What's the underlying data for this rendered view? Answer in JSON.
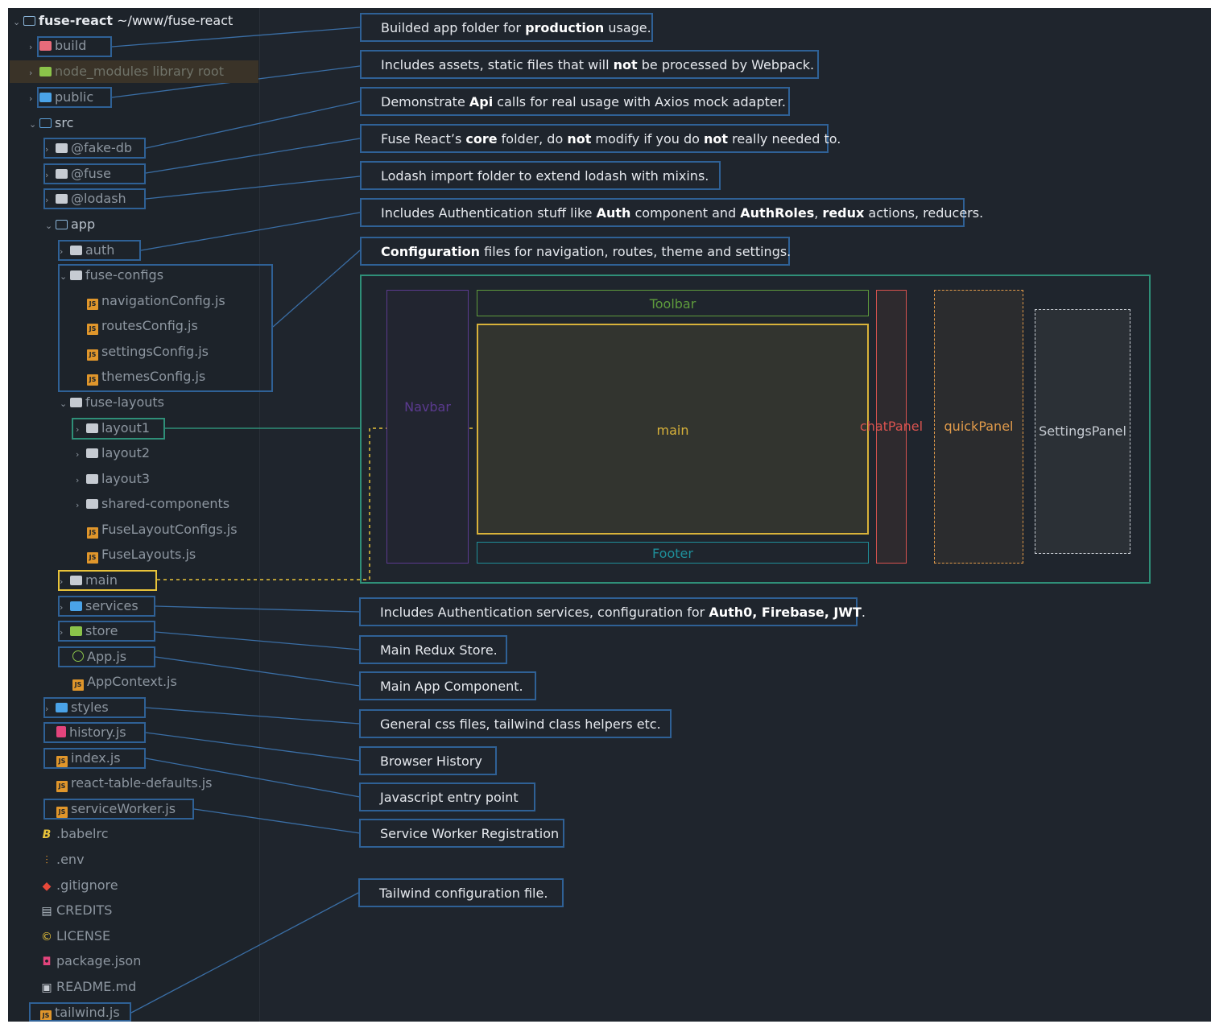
{
  "tree": {
    "root_name": "fuse-react",
    "root_path": "~/www/fuse-react",
    "items": {
      "build": "build",
      "node_modules": "node_modules",
      "node_modules_note": "library root",
      "public": "public",
      "src": "src",
      "fake_db": "@fake-db",
      "fuse": "@fuse",
      "lodash": "@lodash",
      "app": "app",
      "auth": "auth",
      "fuse_configs": "fuse-configs",
      "navigation_config": "navigationConfig.js",
      "routes_config": "routesConfig.js",
      "settings_config": "settingsConfig.js",
      "themes_config": "themesConfig.js",
      "fuse_layouts": "fuse-layouts",
      "layout1": "layout1",
      "layout2": "layout2",
      "layout3": "layout3",
      "shared_components": "shared-components",
      "fuse_layout_configs": "FuseLayoutConfigs.js",
      "fuse_layouts_js": "FuseLayouts.js",
      "main": "main",
      "services": "services",
      "store": "store",
      "app_js": "App.js",
      "app_context": "AppContext.js",
      "styles": "styles",
      "history": "history.js",
      "index": "index.js",
      "react_table": "react-table-defaults.js",
      "service_worker": "serviceWorker.js",
      "babelrc": ".babelrc",
      "env": ".env",
      "gitignore": ".gitignore",
      "credits": "CREDITS",
      "license": "LICENSE",
      "package_json": "package.json",
      "readme": "README.md",
      "tailwind": "tailwind.js"
    }
  },
  "callouts": {
    "build": {
      "a": "Builded app folder for ",
      "b": "production",
      "c": " usage.",
      "d": "",
      "e": ""
    },
    "public": {
      "a": "Includes assets, static files that will ",
      "b": "not",
      "c": " be processed by Webpack.",
      "d": "",
      "e": ""
    },
    "fake_db": {
      "a": "Demonstrate ",
      "b": "Api",
      "c": " calls for real usage with Axios mock adapter.",
      "d": "",
      "e": ""
    },
    "fuse": {
      "a": "Fuse React’s ",
      "b": "core",
      "c": " folder, do ",
      "d": "not",
      "e": " modify if you do ",
      "f": "not",
      "g": " really needed to."
    },
    "lodash": {
      "a": "Lodash import folder to extend lodash with mixins."
    },
    "auth": {
      "a": "Includes Authentication stuff like ",
      "b": "Auth",
      "c": " component and ",
      "d": "AuthRoles",
      "e": ", ",
      "f": "redux",
      "g": " actions, reducers."
    },
    "configs": {
      "a": "Configuration",
      "b": " files for navigation, routes, theme and settings."
    },
    "services": {
      "a": "Includes Authentication services, configuration for ",
      "b": "Auth0, Firebase, JWT",
      "c": "."
    },
    "store": {
      "a": "Main Redux Store."
    },
    "app": {
      "a": "Main App Component."
    },
    "styles": {
      "a": "General css files, tailwind class helpers etc."
    },
    "history": {
      "a": "Browser History"
    },
    "index": {
      "a": "Javascript entry point"
    },
    "service_worker": {
      "a": "Service Worker Registration"
    },
    "tailwind": {
      "a": "Tailwind configuration file."
    }
  },
  "layout_diagram": {
    "navbar": "Navbar",
    "toolbar": "Toolbar",
    "main": "main",
    "footer": "Footer",
    "chat_panel": "chatPanel",
    "quick_panel": "quickPanel",
    "settings_panel": "SettingsPanel"
  },
  "colors": {
    "background": "#1f252d",
    "callout_border": "#2f6196",
    "highlight_yellow": "#e8c33a",
    "layout_green": "#2f8f78",
    "navbar": "#5b3a8f",
    "toolbar": "#5e9b3c",
    "main": "#d8b23a",
    "footer": "#1f8f9a",
    "chat_panel": "#d9534f",
    "quick_panel": "#e09a4a",
    "settings_panel": "#c6cbd2"
  }
}
